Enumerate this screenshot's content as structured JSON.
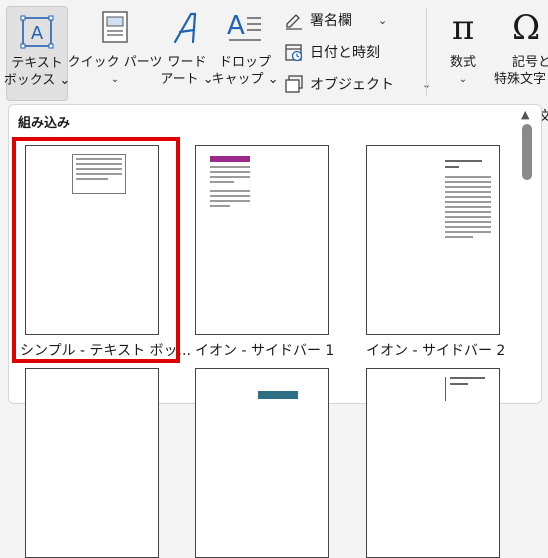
{
  "ribbon": {
    "textbox": {
      "line1": "テキスト",
      "line2": "ボックス ⌄"
    },
    "quickparts": {
      "line1": "クイック パーツ",
      "line2": "⌄"
    },
    "wordart": {
      "line1": "ワード",
      "line2": "アート ⌄"
    },
    "dropcap": {
      "line1": "ドロップ",
      "line2": "キャップ ⌄"
    },
    "signature": "署名欄",
    "datetime": "日付と時刻",
    "object": "オブジェクト",
    "equation": {
      "line1": "数式",
      "line2": "⌄"
    },
    "symbol": {
      "line1": "記号と",
      "line2": "特殊文字"
    },
    "overflow": "文"
  },
  "gallery": {
    "section_title": "組み込み",
    "items": [
      {
        "label": "シンプル - テキスト ボッ..."
      },
      {
        "label": "イオン - サイドバー 1"
      },
      {
        "label": "イオン - サイドバー 2"
      }
    ]
  },
  "colors": {
    "accent_purple": "#9b2a8a",
    "selection_red": "#e00000",
    "teal": "#2f6f86"
  }
}
